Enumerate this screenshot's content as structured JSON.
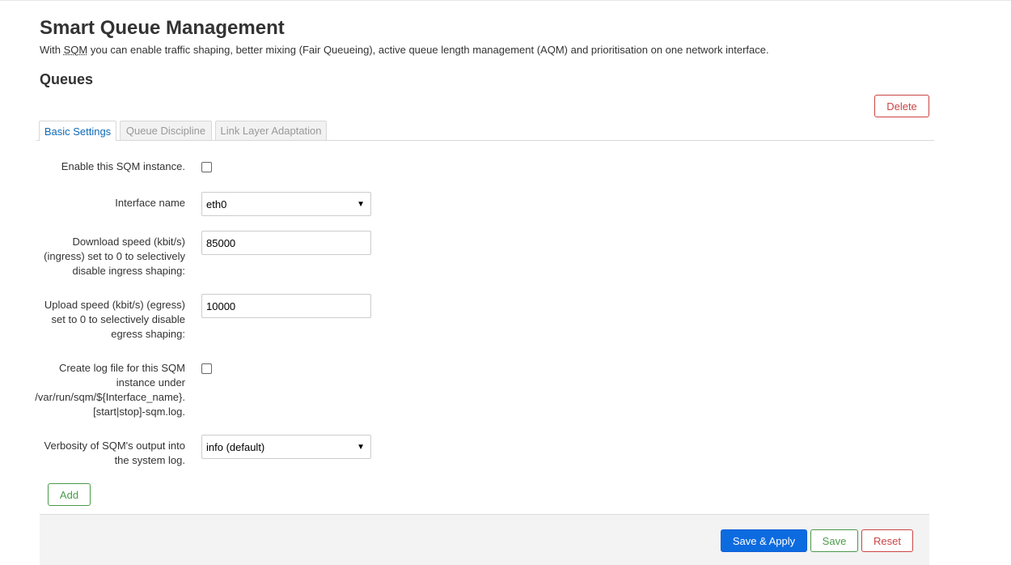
{
  "header": {
    "title": "Smart Queue Management",
    "description_prefix": "With ",
    "description_abbr": "SQM",
    "description_suffix": " you can enable traffic shaping, better mixing (Fair Queueing), active queue length management (AQM) and prioritisation on one network interface."
  },
  "section": {
    "title": "Queues",
    "delete_label": "Delete",
    "add_label": "Add"
  },
  "tabs": [
    {
      "label": "Basic Settings",
      "active": true
    },
    {
      "label": "Queue Discipline",
      "active": false
    },
    {
      "label": "Link Layer Adaptation",
      "active": false
    }
  ],
  "form": {
    "enable": {
      "label": "Enable this SQM instance.",
      "checked": false
    },
    "interface": {
      "label": "Interface name",
      "value": "eth0"
    },
    "download": {
      "label_lines": [
        "Download speed (kbit/s)",
        "(ingress) set to 0 to selectively",
        "disable ingress shaping:"
      ],
      "value": "85000"
    },
    "upload": {
      "label_lines": [
        "Upload speed (kbit/s) (egress)",
        "set to 0 to selectively disable",
        "egress shaping:"
      ],
      "value": "10000"
    },
    "logfile": {
      "label_lines": [
        "Create log file for this SQM",
        "instance under",
        "/var/run/sqm/${Interface_name}.",
        "[start|stop]-sqm.log."
      ],
      "checked": false
    },
    "verbosity": {
      "label_lines": [
        "Verbosity of SQM's output into",
        "the system log."
      ],
      "value": "info (default)"
    }
  },
  "footer": {
    "save_apply_label": "Save & Apply",
    "save_label": "Save",
    "reset_label": "Reset"
  },
  "icons": {
    "select_arrow": "chevron-down-icon"
  }
}
